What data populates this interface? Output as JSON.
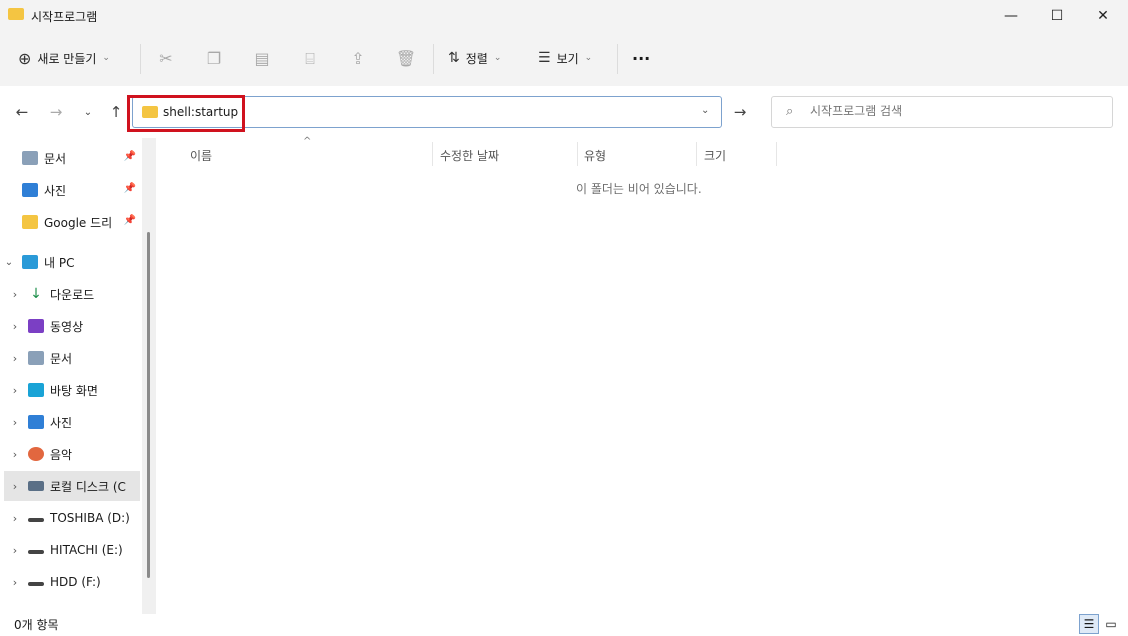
{
  "window": {
    "title": "시작프로그램"
  },
  "toolbar": {
    "new_label": "새로 만들기",
    "sort_label": "정렬",
    "view_label": "보기",
    "more_label": "···"
  },
  "address": {
    "value": "shell:startup"
  },
  "search": {
    "placeholder": "시작프로그램 검색"
  },
  "sidebar": {
    "items": [
      {
        "label": "문서",
        "icon": "document-icon",
        "pinned": true
      },
      {
        "label": "사진",
        "icon": "picture-icon",
        "pinned": true
      },
      {
        "label": "Google 드리",
        "icon": "folder-icon",
        "pinned": true
      },
      {
        "label": "내 PC",
        "icon": "pc-icon",
        "expanded": true
      },
      {
        "label": "다운로드",
        "icon": "download-icon"
      },
      {
        "label": "동영상",
        "icon": "video-icon"
      },
      {
        "label": "문서",
        "icon": "document-icon"
      },
      {
        "label": "바탕 화면",
        "icon": "desktop-icon"
      },
      {
        "label": "사진",
        "icon": "picture-icon"
      },
      {
        "label": "음악",
        "icon": "music-icon"
      },
      {
        "label": "로컬 디스크 (C",
        "icon": "drive-icon",
        "selected": true
      },
      {
        "label": "TOSHIBA (D:)",
        "icon": "drive-icon"
      },
      {
        "label": "HITACHI (E:)",
        "icon": "drive-icon"
      },
      {
        "label": "HDD (F:)",
        "icon": "drive-icon"
      }
    ]
  },
  "columns": {
    "name": "이름",
    "modified": "수정한 날짜",
    "type": "유형",
    "size": "크기"
  },
  "empty_message": "이 폴더는 비어 있습니다.",
  "status": {
    "count": "0개 항목"
  },
  "colors": {
    "highlight": "#d0121e",
    "folder": "#f4c542"
  }
}
